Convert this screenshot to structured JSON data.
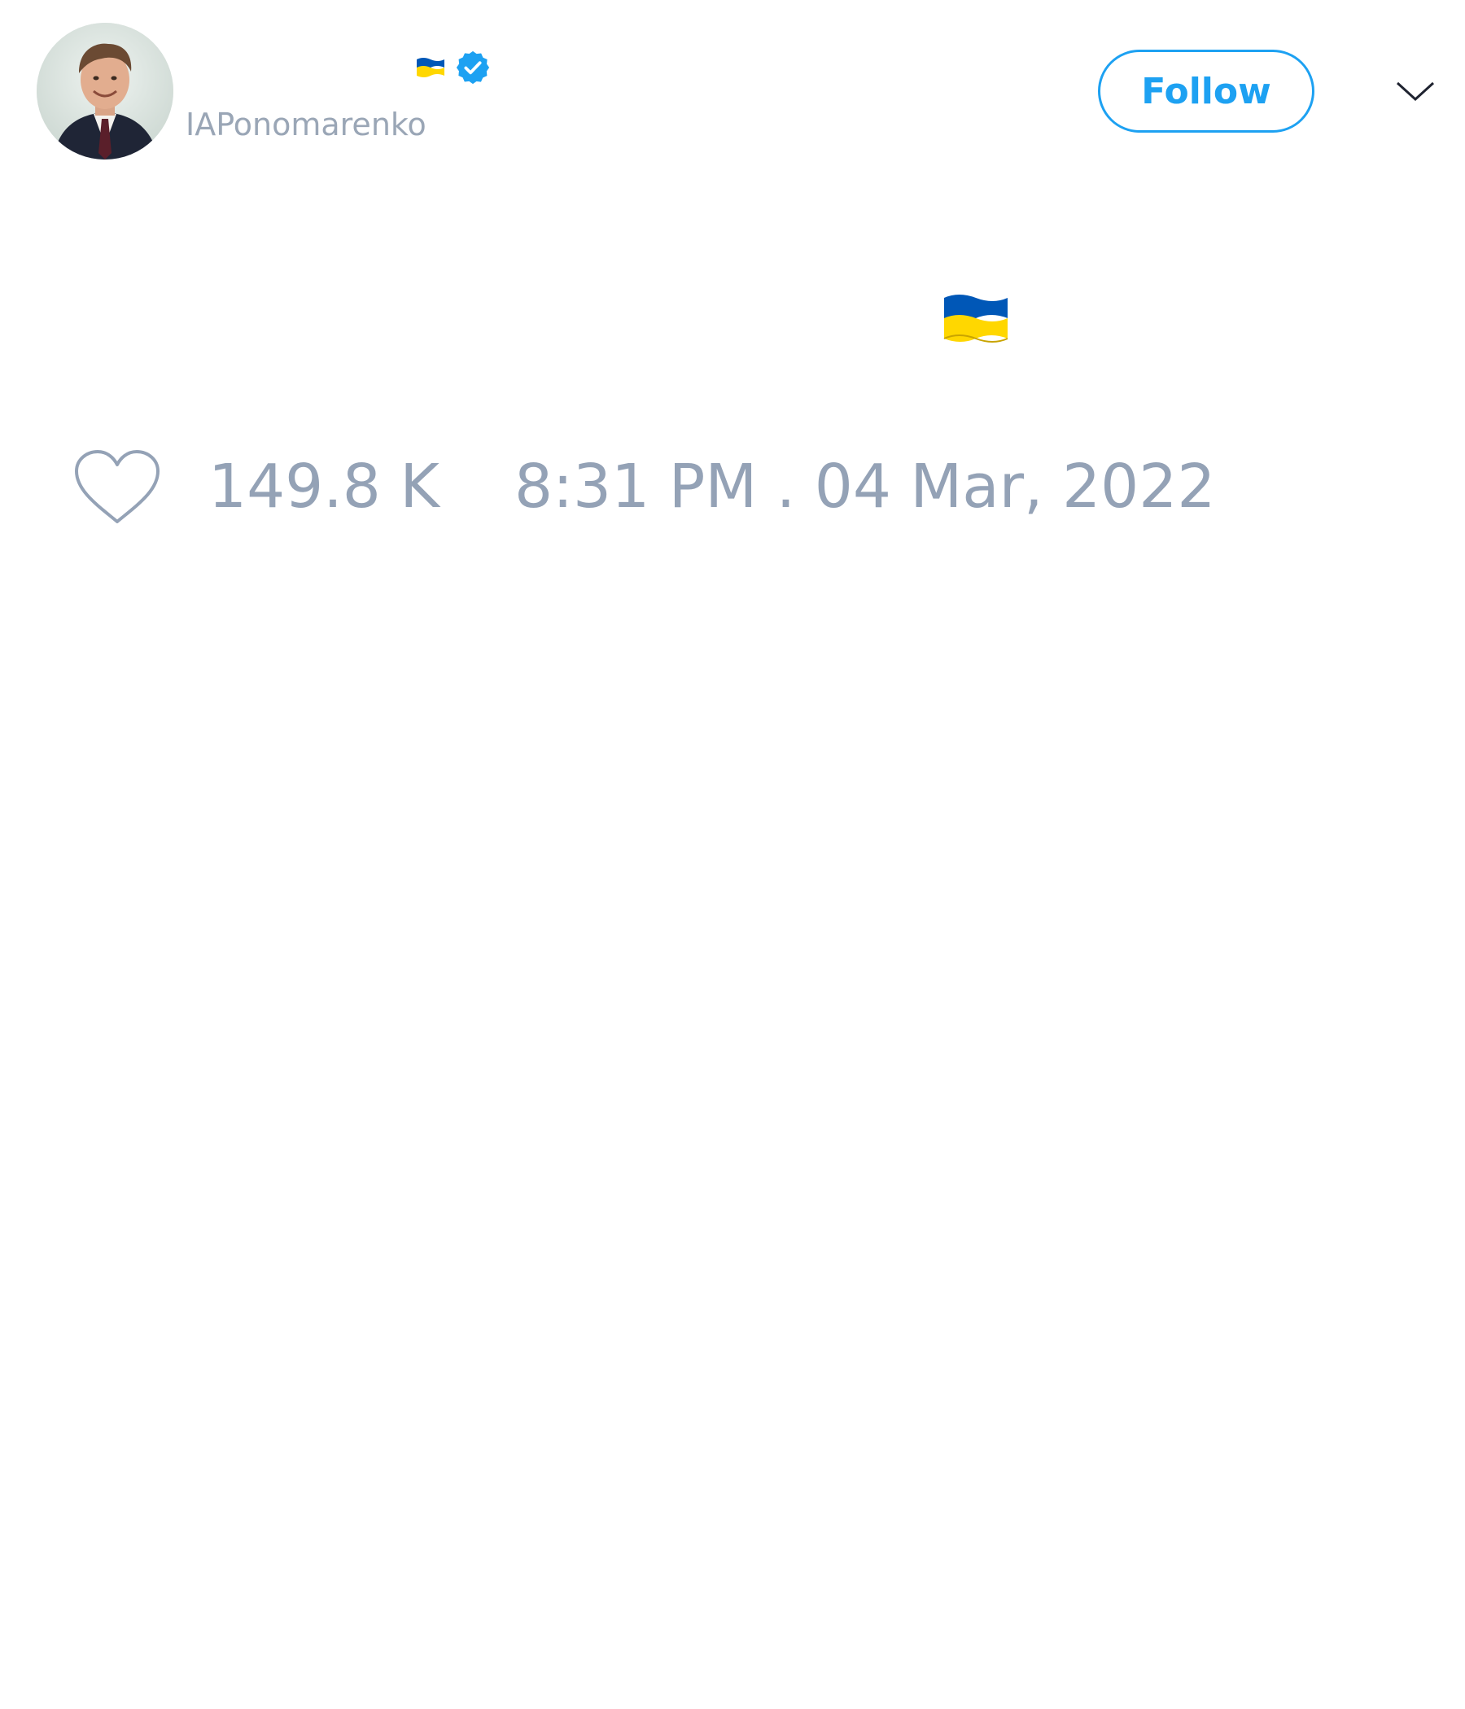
{
  "tweet": {
    "author": {
      "handle": "IAPonomarenko",
      "display_name_emoji": "flag-ukraine",
      "verified": true,
      "avatar": "portrait-photo"
    },
    "follow_label": "Follow",
    "menu_icon": "chevron-down-icon",
    "body_emoji": "flag-ukraine",
    "like_icon": "heart-outline-icon",
    "likes": "149.8 K",
    "timestamp": "8:31 PM . 04 Mar, 2022"
  },
  "colors": {
    "accent": "#1da1f2",
    "muted_text": "#94a2b6",
    "flag_blue": "#0057b7",
    "flag_yellow": "#ffd700",
    "background": "#ffffff"
  }
}
